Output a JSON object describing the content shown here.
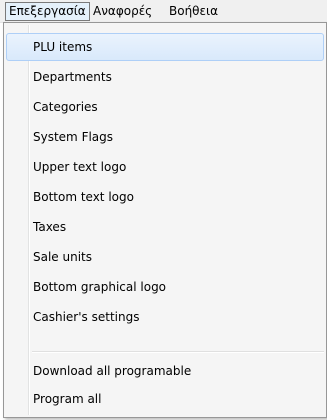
{
  "menubar": {
    "items": [
      {
        "label": "Επεξεργασία",
        "active": true
      },
      {
        "label": "Αναφορές",
        "active": false
      },
      {
        "label": "Βοήθεια",
        "active": false
      }
    ]
  },
  "dropdown": {
    "items": [
      {
        "label": "PLU items",
        "highlighted": true
      },
      {
        "label": "Departments"
      },
      {
        "label": "Categories"
      },
      {
        "label": "System Flags"
      },
      {
        "label": "Upper text logo"
      },
      {
        "label": "Bottom text logo"
      },
      {
        "label": "Taxes"
      },
      {
        "label": "Sale units"
      },
      {
        "label": "Bottom graphical logo"
      },
      {
        "label": "Cashier's settings"
      },
      {
        "label": "Download all programable"
      },
      {
        "label": "Program all"
      }
    ]
  },
  "colors": {
    "highlight": "#d9e9fb",
    "highlight_border": "#aecff7",
    "menu_background": "#f5f5f5",
    "menubar_background": "#f0f0f0"
  }
}
